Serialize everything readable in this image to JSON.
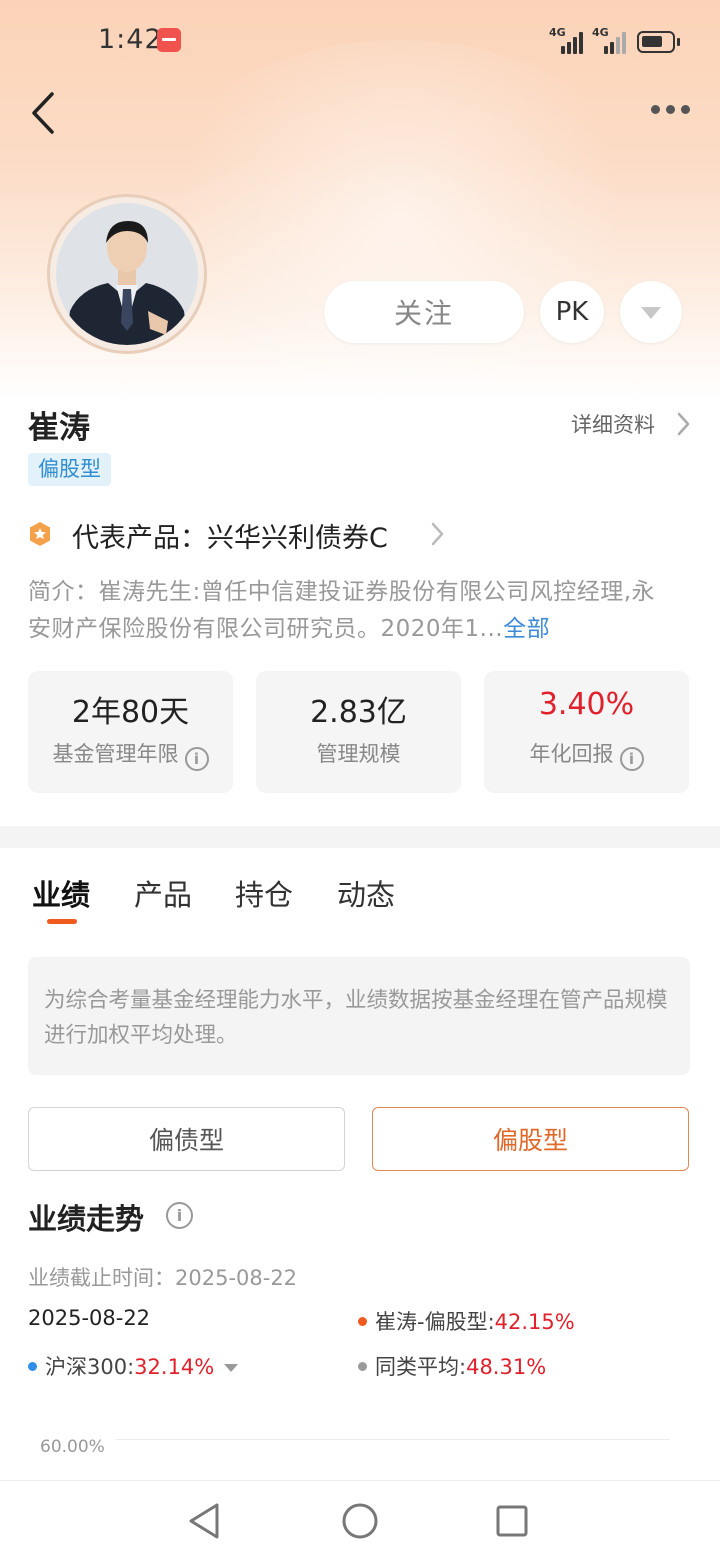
{
  "status_bar": {
    "time": "1:42",
    "network_1": "4G",
    "network_2": "4G"
  },
  "profile": {
    "follow_label": "关注",
    "pk_label": "PK",
    "name": "崔涛",
    "detail_link": "详细资料",
    "type_tag": "偏股型",
    "product_label": "代表产品：兴华兴利债券C",
    "intro_text": "简介：崔涛先生:曾任中信建投证券股份有限公司风控经理,永安财产保险股份有限公司研究员。2020年1...",
    "intro_more": "全部"
  },
  "stats": [
    {
      "value": "2年80天",
      "label": "基金管理年限",
      "has_info": true
    },
    {
      "value": "2.83亿",
      "label": "管理规模",
      "has_info": false
    },
    {
      "value": "3.40%",
      "label": "年化回报",
      "has_info": true,
      "color": "#e0202a"
    }
  ],
  "tabs": [
    {
      "label": "业绩",
      "active": true
    },
    {
      "label": "产品",
      "active": false
    },
    {
      "label": "持仓",
      "active": false
    },
    {
      "label": "动态",
      "active": false
    }
  ],
  "note": "为综合考量基金经理能力水平，业绩数据按基金经理在管产品规模进行加权平均处理。",
  "segments": [
    {
      "label": "偏债型",
      "selected": false
    },
    {
      "label": "偏股型",
      "selected": true
    }
  ],
  "performance": {
    "title": "业绩走势",
    "as_of_label": "业绩截止时间：",
    "as_of_date": "2025-08-22",
    "date": "2025-08-22",
    "legend": [
      {
        "name": "崔涛-偏股型:",
        "value": "42.15%",
        "color": "#f05a1e"
      },
      {
        "name": "沪深300:",
        "value": "32.14%",
        "color": "#2f8fe8"
      },
      {
        "name": "同类平均:",
        "value": "48.31%",
        "color": "#9a9a9a"
      }
    ],
    "y_tick_top": "60.00%"
  },
  "colors": {
    "accent": "#f05a1e",
    "positive": "#e0202a",
    "link": "#3d8bd6"
  }
}
